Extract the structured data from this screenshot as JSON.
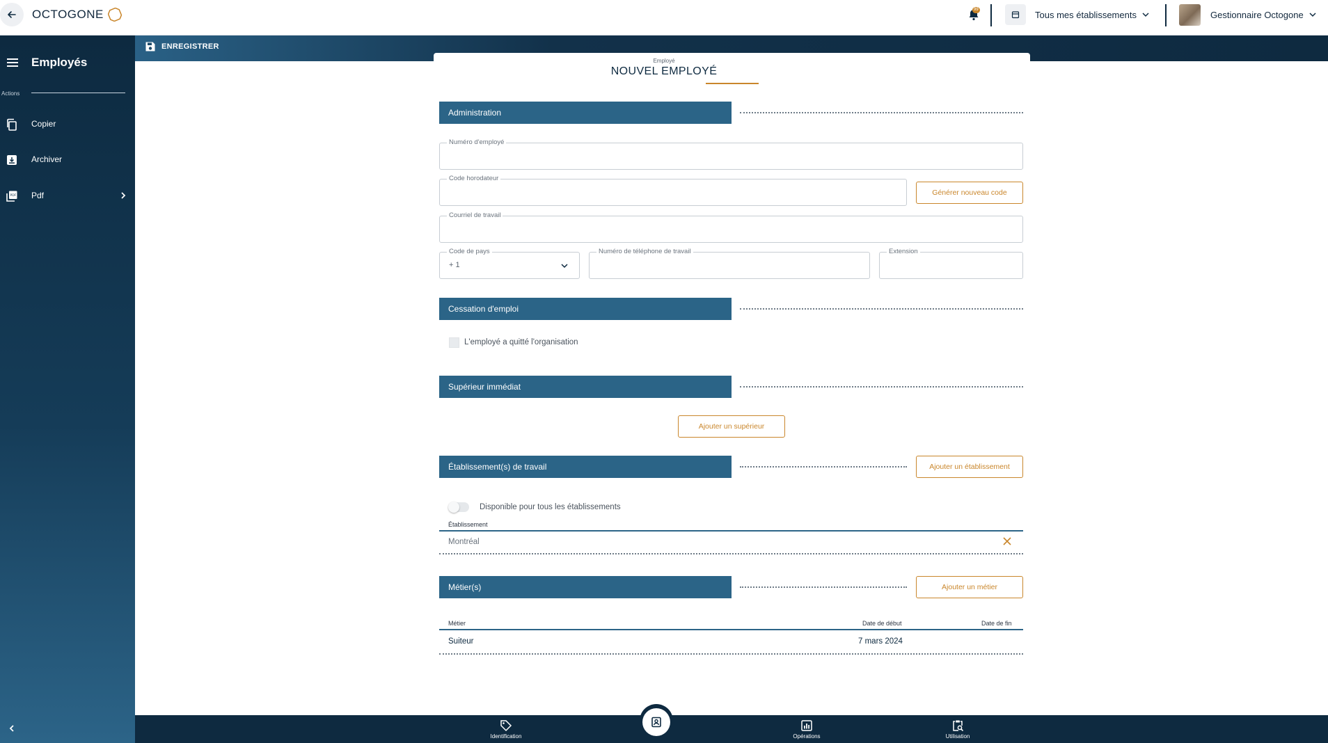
{
  "topbar": {
    "brand": "OCTOGONE",
    "notification_count": "99",
    "establishment_selector": "Tous mes établissements",
    "user_name": "Gestionnaire Octogone"
  },
  "sidebar": {
    "title": "Employés",
    "actions_label": "Actions",
    "items": [
      {
        "label": "Copier",
        "icon": "copy-icon"
      },
      {
        "label": "Archiver",
        "icon": "archive-icon"
      },
      {
        "label": "Pdf",
        "icon": "pdf-icon"
      }
    ]
  },
  "savebar": {
    "save_label": "ENREGISTRER"
  },
  "form": {
    "small_title": "Employé",
    "title": "NOUVEL EMPLOYÉ",
    "sections": {
      "administration": "Administration",
      "cessation": "Cessation d'emploi",
      "superieur": "Supérieur immédiat",
      "etablissements": "Établissement(s) de travail",
      "metiers": "Métier(s)"
    },
    "fields": {
      "employee_number": {
        "label": "Numéro d'employé",
        "value": ""
      },
      "time_clock_code": {
        "label": "Code horodateur",
        "value": ""
      },
      "work_email": {
        "label": "Courriel de travail",
        "value": ""
      },
      "country_code": {
        "label": "Code de pays",
        "value": "+ 1"
      },
      "work_phone": {
        "label": "Numéro de téléphone de travail",
        "value": ""
      },
      "extension": {
        "label": "Extension",
        "value": ""
      }
    },
    "buttons": {
      "generate_code": "Générer nouveau code",
      "add_superior": "Ajouter un supérieur",
      "add_establishment": "Ajouter un établissement",
      "add_trade": "Ajouter un métier"
    },
    "left_org_label": "L'employé a quitté l'organisation",
    "left_org_checked": false,
    "available_all_label": "Disponible pour tous les établissements",
    "available_all_on": false,
    "establishment_field_label": "Établissement",
    "establishment_value": "Montréal",
    "trades_table": {
      "columns": [
        "Métier",
        "Date de début",
        "Date de fin"
      ],
      "rows": [
        {
          "trade": "Suiteur",
          "start": "7 mars 2024",
          "end": ""
        }
      ]
    }
  },
  "bottomnav": {
    "items": [
      {
        "label": "Identification",
        "icon": "tag-icon"
      },
      {
        "label": "Opérations",
        "icon": "bar-chart-icon"
      },
      {
        "label": "Utilisation",
        "icon": "clipboard-search-icon"
      }
    ],
    "center_icon": "employee-badge-icon"
  },
  "colors": {
    "navy": "#0e2a40",
    "section_blue": "#2b6487",
    "accent_gold": "#c9862b"
  }
}
